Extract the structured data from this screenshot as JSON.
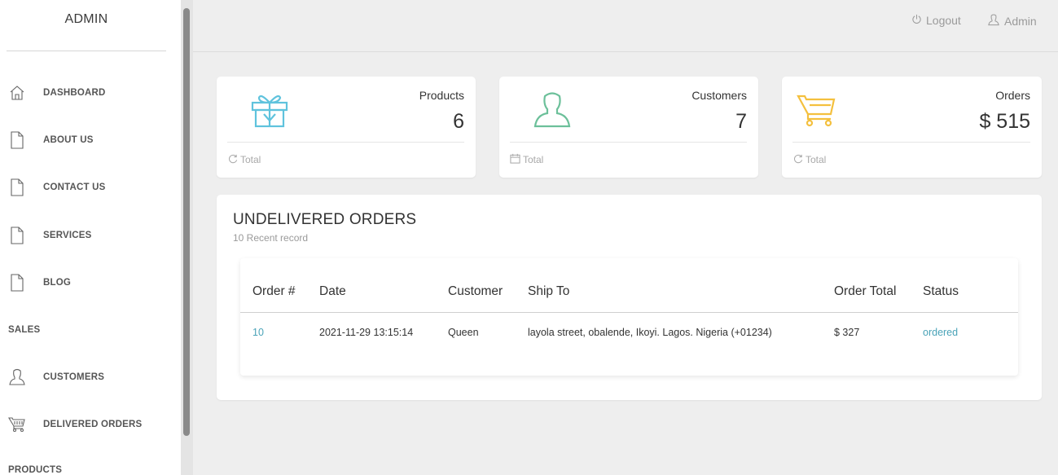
{
  "sidebar": {
    "brand": "ADMIN",
    "items": [
      {
        "label": "DASHBOARD",
        "icon": "home-icon"
      },
      {
        "label": "ABOUT US",
        "icon": "document-icon"
      },
      {
        "label": "CONTACT US",
        "icon": "document-icon"
      },
      {
        "label": "SERVICES",
        "icon": "document-icon"
      },
      {
        "label": "BLOG",
        "icon": "document-icon"
      }
    ],
    "sections": {
      "sales": "SALES",
      "products": "PRODUCTS"
    },
    "sales_items": [
      {
        "label": "CUSTOMERS",
        "icon": "user-icon"
      },
      {
        "label": "DELIVERED ORDERS",
        "icon": "cart-icon"
      }
    ]
  },
  "topbar": {
    "logout": "Logout",
    "admin": "Admin"
  },
  "cards": [
    {
      "label": "Products",
      "value": "6",
      "footer": "Total",
      "icon": "gift-icon",
      "color": "#5fc3dd"
    },
    {
      "label": "Customers",
      "value": "7",
      "footer": "Total",
      "icon": "user-icon",
      "color": "#6cc09a"
    },
    {
      "label": "Orders",
      "value": "$ 515",
      "footer": "Total",
      "icon": "cart-icon",
      "color": "#f4c03e"
    }
  ],
  "orders": {
    "title": "UNDELIVERED ORDERS",
    "subtitle": "10 Recent record",
    "columns": [
      "Order #",
      "Date",
      "Customer",
      "Ship To",
      "Order Total",
      "Status"
    ],
    "rows": [
      {
        "order": "10",
        "date": "2021-11-29 13:15:14",
        "customer": "Queen",
        "ship_to": "layola street, obalende, Ikoyi. Lagos. Nigeria (+01234)",
        "total": "$ 327",
        "status": "ordered"
      }
    ]
  },
  "colors": {
    "link": "#4aa3b8",
    "background": "#eeeeee"
  }
}
